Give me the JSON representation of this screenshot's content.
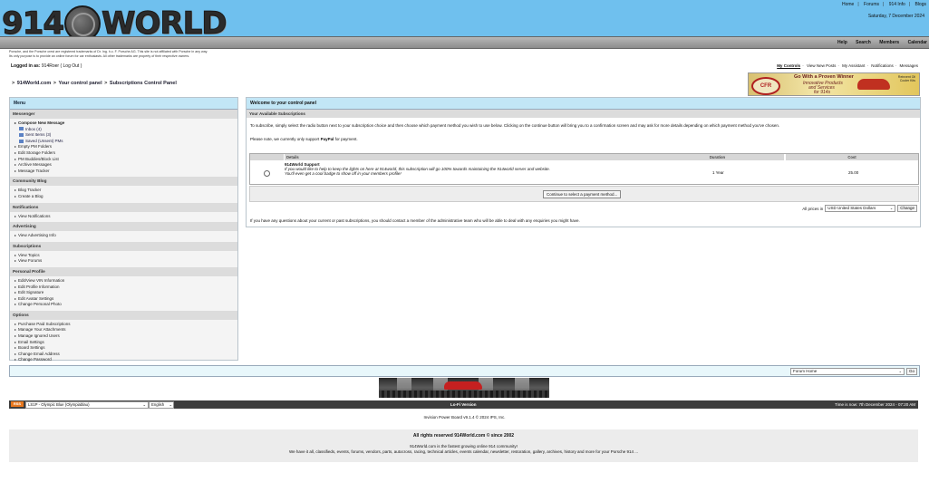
{
  "logo": {
    "number": "914",
    "word": "WORLD"
  },
  "top_links": [
    "Home",
    "Forums",
    "914 Info",
    "Blogs"
  ],
  "date": "Saturday, 7 December 2024",
  "nav_links": [
    "Help",
    "Search",
    "Members",
    "Calendar"
  ],
  "disclaimer": {
    "line1": "Porsche, and the Porsche crest are registered trademarks of Dr. Ing. h.c. F. Porsche AG. This site is not affiliated with Porsche in any way.",
    "line2": "Its only purpose is to provide an online forum for car enthusiasts. All other trademarks are property of their respective owners."
  },
  "logged_in": {
    "label": "Logged in as:",
    "user": "914Roer",
    "logout": "Log Out"
  },
  "user_menu": [
    "My Controls",
    "View New Posts",
    "My Assistant",
    "Notifications",
    "Messages"
  ],
  "ad": {
    "logo": "CFR",
    "line1": "Go With a Proven Winner",
    "line2": "Innovative Products",
    "line3": "and Services",
    "line4": "for 914s",
    "side": "Reinvent Oil Cooler Kits"
  },
  "breadcrumb": [
    "914World.com",
    "Your control panel",
    "Subscriptions Control Panel"
  ],
  "sidebar": {
    "title": "Menu",
    "sections": {
      "messenger": {
        "title": "Messenger",
        "compose": "Compose New Message",
        "inbox": "Inbox (4)",
        "sent": "Sent Items (3)",
        "saved": "Saved (Unsent) PMs",
        "empty": "Empty PM Folders",
        "edit_storage": "Edit Storage Folders",
        "buddies": "PM Buddies/Block List",
        "archive": "Archive Messages",
        "tracker": "Message Tracker"
      },
      "blog": {
        "title": "Community Blog",
        "tracker": "Blog Tracker",
        "create": "Create a Blog"
      },
      "notifications": {
        "title": "Notifications",
        "view": "View Notifications"
      },
      "advertising": {
        "title": "Advertising",
        "view": "View Advertising Info"
      },
      "subscriptions": {
        "title": "Subscriptions",
        "topics": "View Topics",
        "forums": "View Forums"
      },
      "profile": {
        "title": "Personal Profile",
        "vin": "Edit/View VIN Information",
        "info": "Edit Profile Information",
        "signature": "Edit Signature",
        "avatar": "Edit Avatar Settings",
        "photo": "Change Personal Photo"
      },
      "options": {
        "title": "Options",
        "purchase": "Purchase Paid Subscriptions",
        "attachments": "Manage Your Attachments",
        "ignored": "Manage Ignored Users",
        "email": "Email Settings",
        "board": "Board Settings",
        "change_email": "Change Email Address",
        "change_password": "Change Password"
      }
    }
  },
  "main": {
    "title": "Welcome to your control panel",
    "subtitle": "Your Available Subscriptions",
    "intro": "To subscribe, simply select the radio button next to your subscription choice and then choose which payment method you wish to use below. Clicking on the continue button will bring you to a confirmation screen and may ask for more details depending on which payment method you've chosen.",
    "note_prefix": "Please note, we currently only support",
    "note_bold": "PayPal",
    "note_suffix": "for payment.",
    "table": {
      "headers": [
        "Details",
        "Duration",
        "Cost"
      ],
      "row": {
        "name": "914World Support",
        "desc1": "If you would like to help to keep the lights on here at 914world, this subscription will go 100% towards maintaining the 914world server and website.",
        "desc2": "You'll even get a cool badge to show off in your members profile!",
        "duration": "1 Year",
        "cost": "25.00"
      }
    },
    "continue_button": "Continue to select a payment method...",
    "prices_label": "All prices in",
    "currency": "USD United States Dollars",
    "change_button": "Change",
    "questions": "If you have any questions about your current or past subscriptions, you should contact a member of the administrative team who will be able to deal with any enquiries you might have."
  },
  "jump": {
    "selected": "Forum Home",
    "go": "Go"
  },
  "footer": {
    "rss": "RSS",
    "skin": "LS1P - Olympic Blue (Olympiablau)",
    "language": "English",
    "lofi": "Lo-Fi Version",
    "time": "Time is now: 7th December 2024 - 07:20 AM",
    "powered": "Invision Power Board v9.1.4 © 2024  IPS, Inc.",
    "rights": "All rights reserved 914World.com © since 2002",
    "tagline1": "914World.com is the fastest growing online 914 community!",
    "tagline2": "We have it all, classifieds, events, forums, vendors, parts, autocross, racing, technical articles, events calendar, newsletter, restoration, gallery, archives, history and more for your Porsche 914 ..."
  }
}
